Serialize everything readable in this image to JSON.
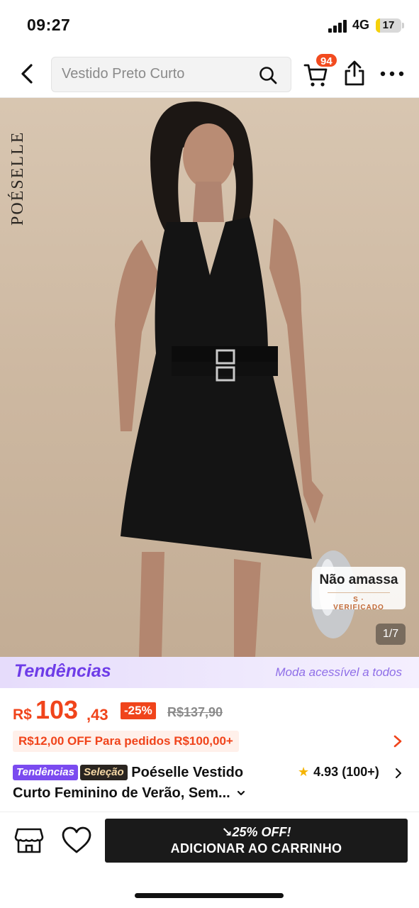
{
  "status_bar": {
    "time": "09:27",
    "network": "4G",
    "battery": "17",
    "battery_level": 0.17
  },
  "header": {
    "search_text": "Vestido Preto Curto",
    "cart_count": "94",
    "icons": [
      "back-icon",
      "search-icon",
      "cart-icon",
      "share-icon",
      "more-icon"
    ]
  },
  "hero": {
    "brand_mark": "POÉSELLE",
    "badge_title": "Não amassa",
    "badge_sub": "S · VERIFICADO",
    "page_counter": "1/7"
  },
  "trend_banner": {
    "logo": "Tendências",
    "tagline": "Moda acessível a todos"
  },
  "price": {
    "currency": "R$",
    "integer": "103",
    "cents": ",43",
    "discount": "-25%",
    "old_price": "R$137,90"
  },
  "coupon": {
    "text": "R$12,00 OFF Para pedidos R$100,00+"
  },
  "product": {
    "tag_trend": "Tendências",
    "tag_selection": "Seleção",
    "title_line1": "Poéselle Vestido",
    "title_line2": "Curto Feminino de Verão, Sem...",
    "rating": "4.93",
    "rating_count": "(100+)"
  },
  "bottom_bar": {
    "promo": "25% OFF!",
    "add_to_cart": "ADICIONAR AO CARRINHO"
  },
  "colors": {
    "accent": "#f0441b",
    "trend_purple": "#6e3ce8",
    "cta_bg": "#1a1a1a"
  }
}
